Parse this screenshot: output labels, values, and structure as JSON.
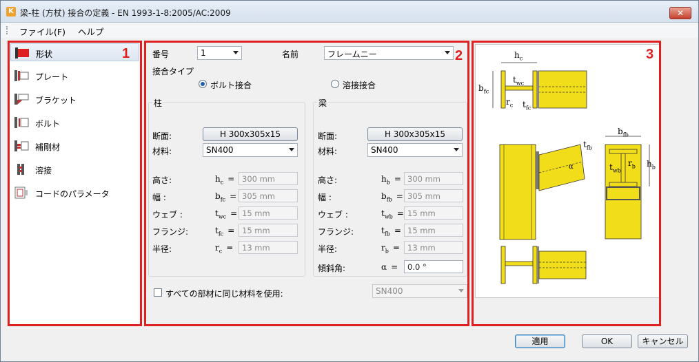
{
  "window": {
    "title": "梁-柱 (方杖) 接合の定義 - EN 1993-1-8:2005/AC:2009",
    "close": "✕"
  },
  "menu": {
    "file": "ファイル(F)",
    "help": "ヘルプ"
  },
  "panel_numbers": [
    "1",
    "2",
    "3"
  ],
  "nav": {
    "items": [
      {
        "label": "形状",
        "icon": "shape-icon"
      },
      {
        "label": "プレート",
        "icon": "plate-icon"
      },
      {
        "label": "ブラケット",
        "icon": "bracket-icon"
      },
      {
        "label": "ボルト",
        "icon": "bolt-icon"
      },
      {
        "label": "補剛材",
        "icon": "stiffener-icon"
      },
      {
        "label": "溶接",
        "icon": "weld-icon"
      },
      {
        "label": "コードのパラメータ",
        "icon": "code-parameters-icon"
      }
    ],
    "selected": 0
  },
  "general": {
    "number_label": "番号",
    "number_value": "1",
    "name_label": "名前",
    "name_value": "フレームニー",
    "conn_type_label": "接合タイプ",
    "bolted_label": "ボルト接合",
    "welded_label": "溶接接合",
    "selected_type": "bolted"
  },
  "column": {
    "title": "柱",
    "section_label": "断面:",
    "section_value": "H 300x305x15",
    "material_label": "材料:",
    "material_value": "SN400",
    "rows": [
      {
        "label": "高さ:",
        "sym": "h",
        "sub": "c",
        "eq": "=",
        "value": "300 mm"
      },
      {
        "label": "幅 :",
        "sym": "b",
        "sub": "fc",
        "eq": "=",
        "value": "305 mm"
      },
      {
        "label": "ウェブ :",
        "sym": "t",
        "sub": "wc",
        "eq": "=",
        "value": "15 mm"
      },
      {
        "label": "フランジ:",
        "sym": "t",
        "sub": "fc",
        "eq": "=",
        "value": "15 mm"
      },
      {
        "label": "半径:",
        "sym": "r",
        "sub": "c",
        "eq": "=",
        "value": "13 mm"
      }
    ]
  },
  "beam": {
    "title": "梁",
    "section_label": "断面:",
    "section_value": "H 300x305x15",
    "material_label": "材料:",
    "material_value": "SN400",
    "rows": [
      {
        "label": "高さ:",
        "sym": "h",
        "sub": "b",
        "eq": "=",
        "value": "300 mm"
      },
      {
        "label": "幅 :",
        "sym": "b",
        "sub": "fb",
        "eq": "=",
        "value": "305 mm"
      },
      {
        "label": "ウェブ :",
        "sym": "t",
        "sub": "wb",
        "eq": "=",
        "value": "15 mm"
      },
      {
        "label": "フランジ:",
        "sym": "t",
        "sub": "fb",
        "eq": "=",
        "value": "15 mm"
      },
      {
        "label": "半径:",
        "sym": "r",
        "sub": "b",
        "eq": "=",
        "value": "13 mm"
      },
      {
        "label": "傾斜角:",
        "sym": "α",
        "sub": "",
        "eq": "=",
        "value": "0.0 °"
      }
    ]
  },
  "same_material": {
    "label": "すべての部材に同じ材料を使用:",
    "value": "SN400",
    "checked": false
  },
  "diagram_labels": {
    "hc": "h",
    "hc_sub": "c",
    "bfc": "b",
    "bfc_sub": "fc",
    "twc": "t",
    "twc_sub": "wc",
    "rc": "r",
    "rc_sub": "c",
    "tfc": "t",
    "tfc_sub": "fc",
    "bfb": "b",
    "bfb_sub": "fb",
    "tfb": "t",
    "tfb_sub": "fb",
    "twb": "t",
    "twb_sub": "wb",
    "rb": "r",
    "rb_sub": "b",
    "hb": "h",
    "hb_sub": "b",
    "alpha": "α"
  },
  "buttons": {
    "apply": "適用",
    "ok": "OK",
    "cancel": "キャンセル"
  },
  "colors": {
    "accent_red": "#e02020",
    "steel_yellow": "#f2dd1a"
  }
}
